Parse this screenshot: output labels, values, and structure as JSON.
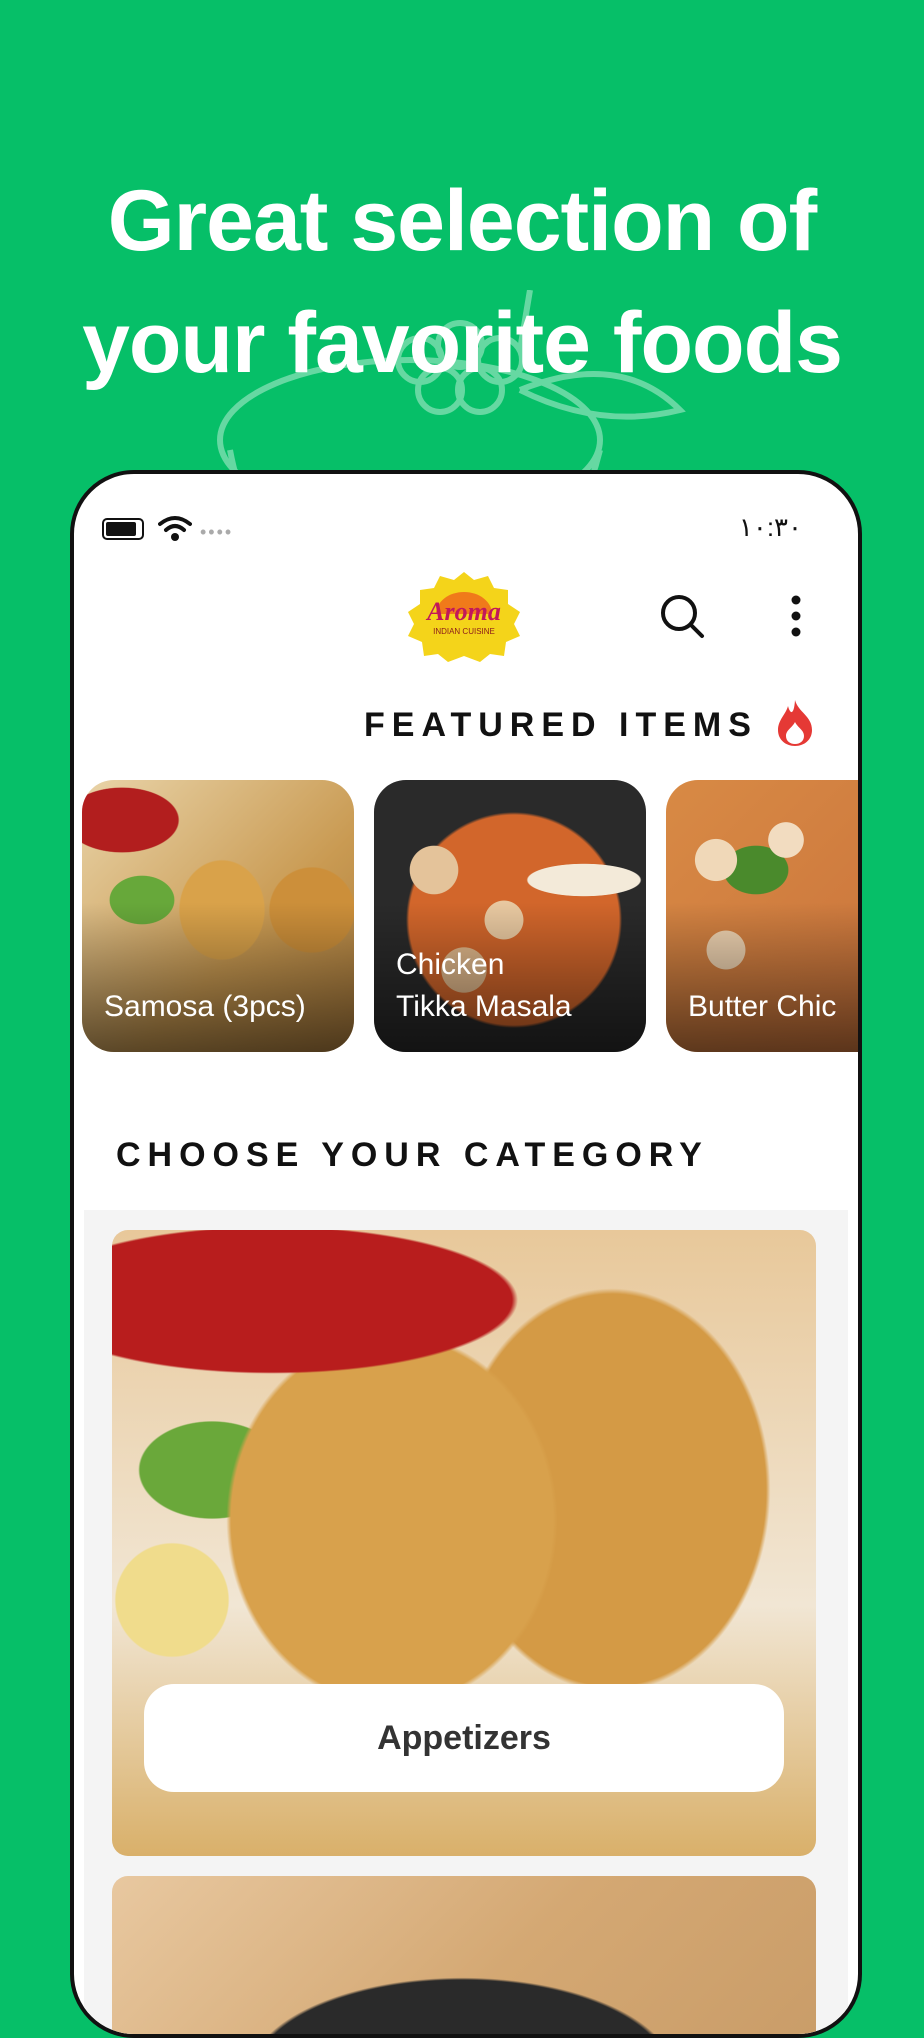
{
  "headline": {
    "line1": "Great selection of",
    "line2": "your favorite foods"
  },
  "status_bar": {
    "time": "١٠:٣٠",
    "signal": "••••"
  },
  "app": {
    "logo_text": "Aroma",
    "logo_subtext": "INDIAN CUISINE"
  },
  "featured": {
    "title": "FEATURED ITEMS",
    "items": [
      {
        "line1": "Samosa (3pcs)",
        "line2": ""
      },
      {
        "line1": "Chicken",
        "line2": "Tikka Masala"
      },
      {
        "line1": "Butter Chic",
        "line2": ""
      }
    ]
  },
  "categories": {
    "title": "CHOOSE YOUR CATEGORY",
    "items": [
      {
        "label": "Appetizers"
      }
    ]
  },
  "colors": {
    "background": "#06BF68",
    "flame": "#E53935",
    "logo_yellow": "#F4D41A"
  },
  "icons": [
    "battery-icon",
    "wifi-icon",
    "search-icon",
    "more-vertical-icon",
    "flame-icon",
    "bowl-illustration"
  ]
}
